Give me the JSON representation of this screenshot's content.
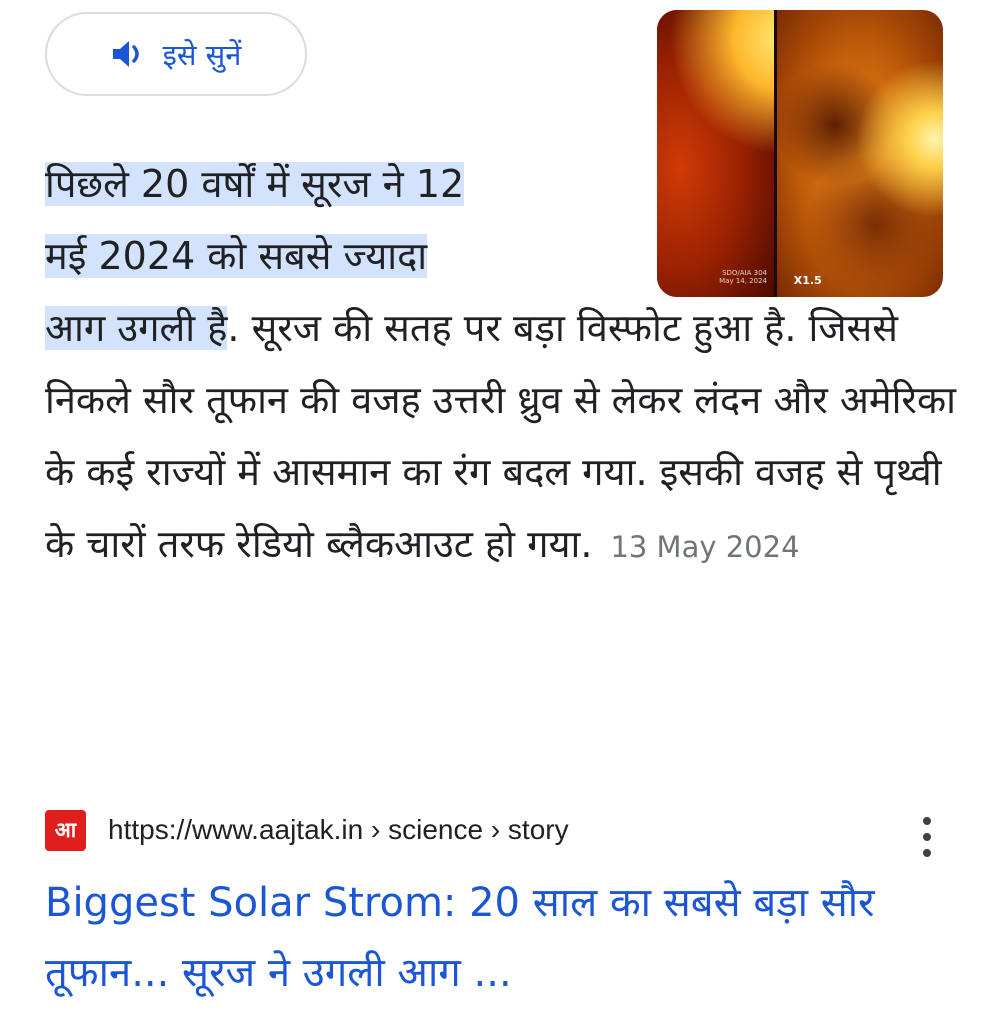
{
  "listen": {
    "label": "इसे सुनें",
    "icon": "speaker-icon",
    "color": "#1a56d6"
  },
  "thumbnail": {
    "caption_left_line1": "SDO/AIA 304",
    "caption_left_line2": "May 14, 2024",
    "caption_right": "X1.5"
  },
  "answer": {
    "highlight_line1": "पिछले 20 वर्षों में सूरज ने 12",
    "highlight_line2": "मई 2024 को सबसे ज्यादा",
    "highlight_line3": "आग उगली है",
    "continuation": ". सूरज की सतह पर बड़ा विस्फोट हुआ है. जिससे निकले सौर तूफान की वजह उत्तरी ध्रुव से लेकर लंदन और अमेरिका के कई राज्यों में आसमान का रंग बदल गया. इसकी वजह से पृथ्वी के चारों तरफ रेडियो ब्लैकआउट हो गया.",
    "date": "13 May 2024",
    "highlight_color": "#d3e3fd"
  },
  "source": {
    "favicon_text": "आ",
    "favicon_color": "#e01e1e",
    "url": "https://www.aajtak.in › science › story",
    "menu_icon": "more-vert-icon"
  },
  "result": {
    "title": "Biggest Solar Strom: 20 साल का सबसे बड़ा सौर तूफान... सूरज ने उगली आग ...",
    "link_color": "#1a56d6"
  }
}
